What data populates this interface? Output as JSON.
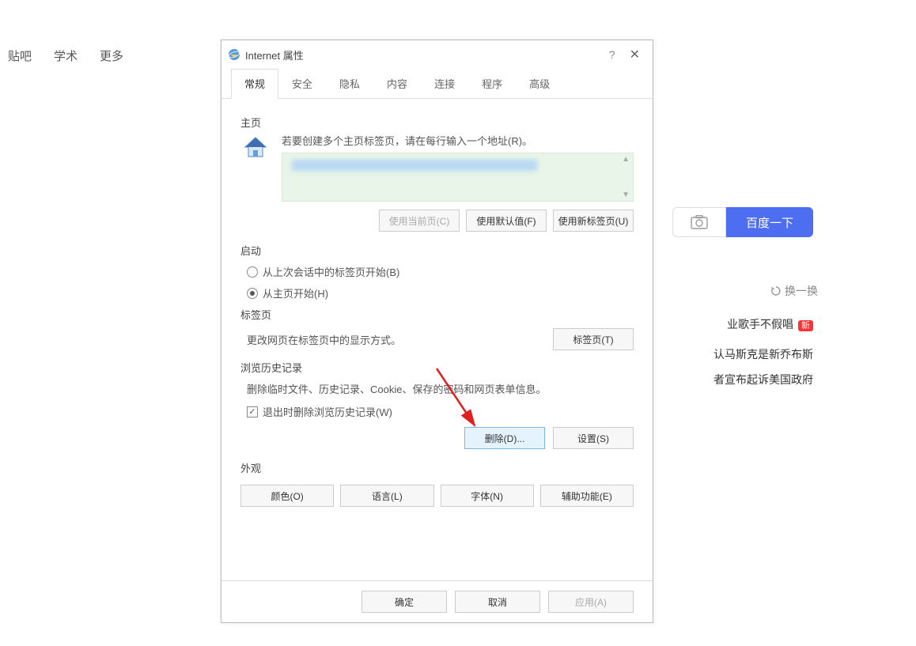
{
  "bg_nav": {
    "item1": "贴吧",
    "item2": "学术",
    "item3": "更多"
  },
  "bg_search": {
    "button": "百度一下"
  },
  "bg_refresh": "换一换",
  "bg_news": {
    "item1": "业歌手不假唱",
    "badge1": "新",
    "item2": "认马斯克是新乔布斯",
    "item3": "者宣布起诉美国政府"
  },
  "dialog": {
    "title": "Internet 属性",
    "tabs": {
      "general": "常规",
      "security": "安全",
      "privacy": "隐私",
      "content": "内容",
      "connections": "连接",
      "programs": "程序",
      "advanced": "高级"
    },
    "homepage": {
      "label": "主页",
      "desc": "若要创建多个主页标签页，请在每行输入一个地址(R)。",
      "use_current": "使用当前页(C)",
      "use_default": "使用默认值(F)",
      "use_newtab": "使用新标签页(U)"
    },
    "startup": {
      "label": "启动",
      "radio1": "从上次会话中的标签页开始(B)",
      "radio2": "从主页开始(H)"
    },
    "tabs_section": {
      "label": "标签页",
      "desc": "更改网页在标签页中的显示方式。",
      "button": "标签页(T)"
    },
    "history": {
      "label": "浏览历史记录",
      "desc": "删除临时文件、历史记录、Cookie、保存的密码和网页表单信息。",
      "checkbox": "退出时删除浏览历史记录(W)",
      "delete_btn": "删除(D)...",
      "settings_btn": "设置(S)"
    },
    "appearance": {
      "label": "外观",
      "colors": "颜色(O)",
      "language": "语言(L)",
      "fonts": "字体(N)",
      "accessibility": "辅助功能(E)"
    },
    "footer": {
      "ok": "确定",
      "cancel": "取消",
      "apply": "应用(A)"
    }
  }
}
